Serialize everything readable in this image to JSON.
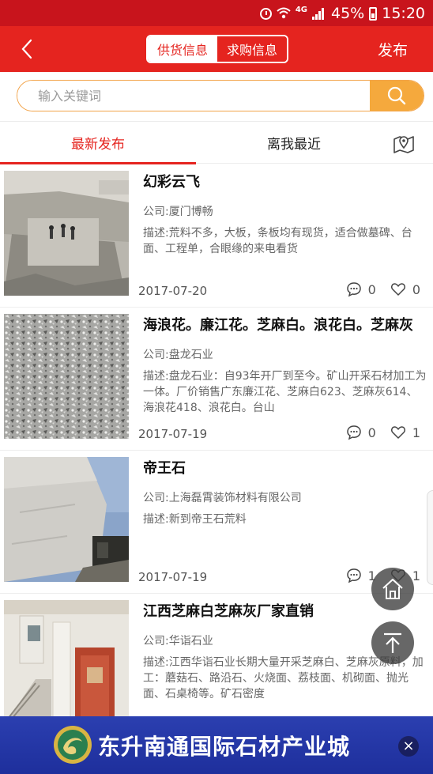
{
  "status_bar": {
    "network_label": "4G",
    "battery": "45%",
    "time": "15:20"
  },
  "header": {
    "back_icon": "chevron-left-icon",
    "tabs": [
      {
        "label": "供货信息",
        "selected": true
      },
      {
        "label": "求购信息",
        "selected": false
      }
    ],
    "publish_label": "发布"
  },
  "search": {
    "placeholder": "输入关键词"
  },
  "sort_tabs": {
    "latest": "最新发布",
    "nearby": "离我最近",
    "map_icon": "map-pin-icon"
  },
  "listings": [
    {
      "title": "幻彩云飞",
      "company": "公司:厦门博畅",
      "description": "描述:荒料不多，大板，条板均有现货，适合做墓碑、台面、工程单，合眼缘的来电看货",
      "date": "2017-07-20",
      "comments": "0",
      "likes": "0"
    },
    {
      "title": "海浪花。廉江花。芝麻白。浪花白。芝麻灰",
      "company": "公司:盘龙石业",
      "description": "描述:盘龙石业：自93年开厂到至今。矿山开采石材加工为一体。厂价销售广东廉江花、芝麻白623、芝麻灰614、海浪花418、浪花白。台山",
      "date": "2017-07-19",
      "comments": "0",
      "likes": "1"
    },
    {
      "title": "帝王石",
      "company": "公司:上海磊霄装饰材料有限公司",
      "description": "描述:新到帝王石荒料",
      "date": "2017-07-19",
      "comments": "1",
      "likes": "1"
    },
    {
      "title": "江西芝麻白芝麻灰厂家直销",
      "company": "公司:华诣石业",
      "description": "描述:江西华诣石业长期大量开采芝麻白、芝麻灰原料，加工：蘑菇石、路沿石、火烧面、荔枝面、机砌面、抛光面、石桌椅等。矿石密度",
      "date": "",
      "comments": "",
      "likes": ""
    }
  ],
  "floating": {
    "home_icon": "home-icon",
    "top_icon": "back-to-top-icon"
  },
  "banner": {
    "text": "东升南通国际石材产业城",
    "close": "×"
  },
  "colors": {
    "primary_red": "#e5241f",
    "status_red": "#c8141c",
    "search_orange": "#f5a93d",
    "banner_blue": "#2b3fb0"
  }
}
